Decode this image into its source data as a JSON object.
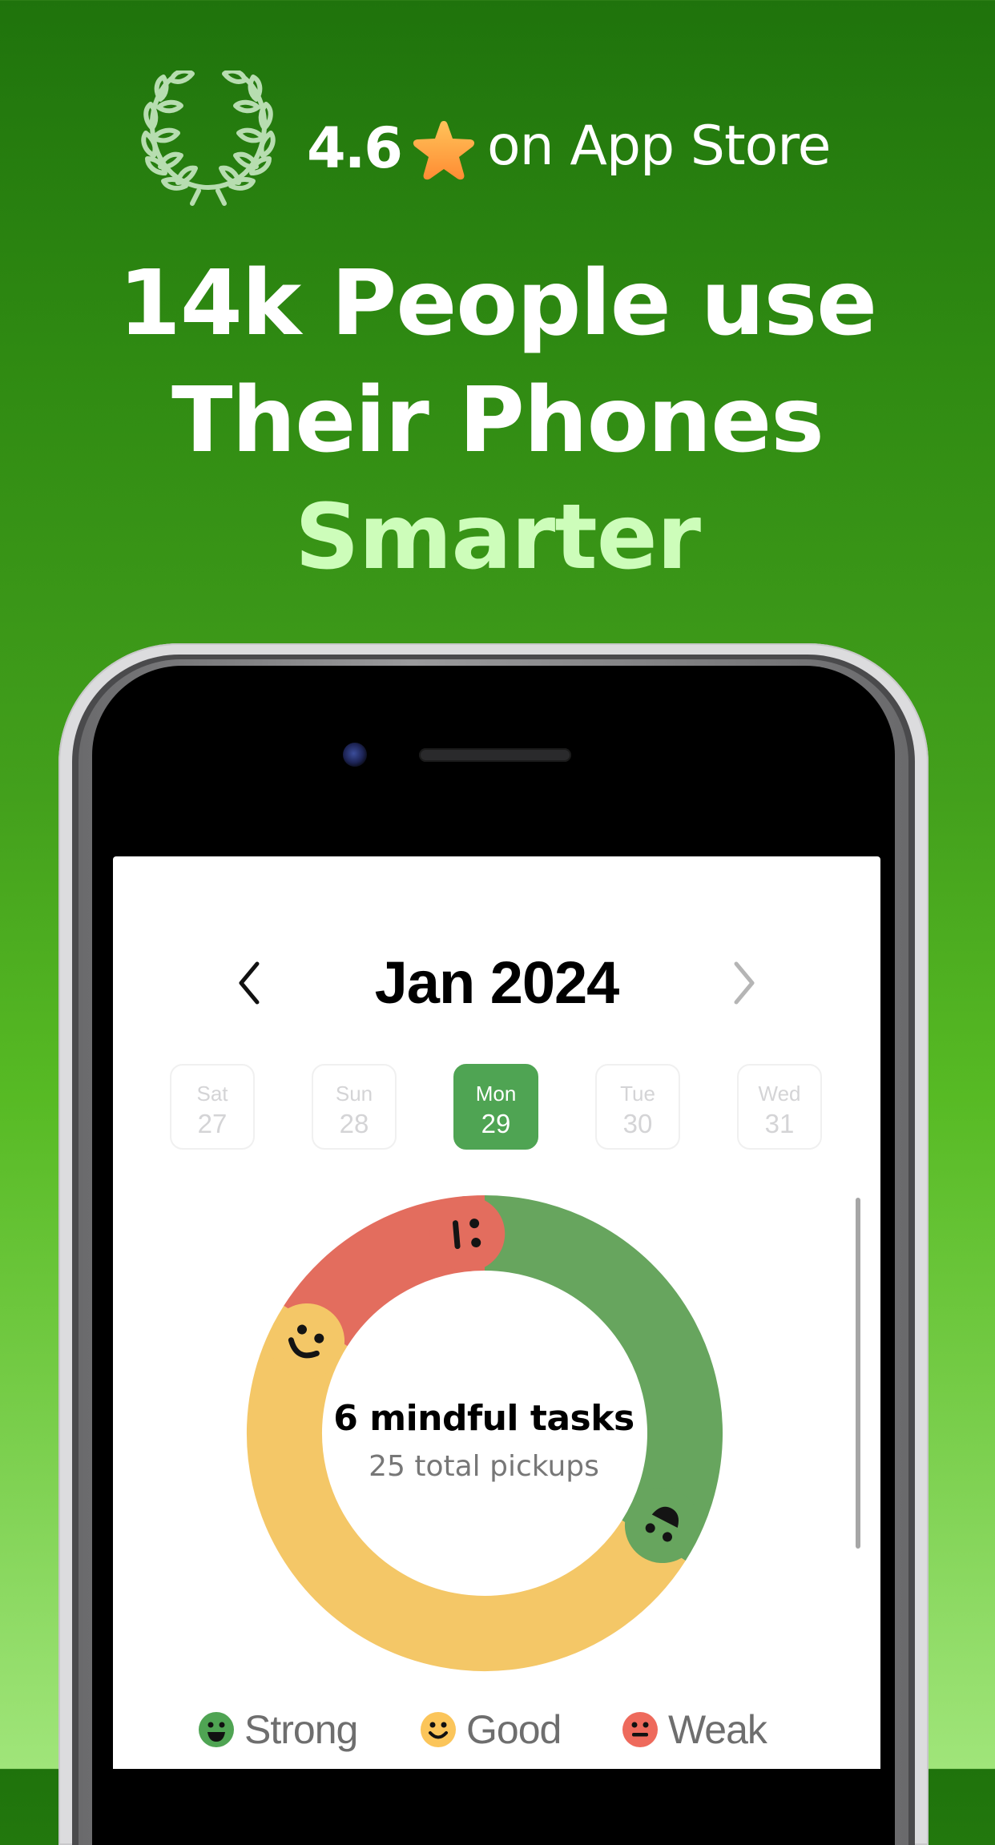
{
  "rating": {
    "value": "4.6",
    "suffix": "on App Store",
    "icons": {
      "laurel": "laurel-wreath-icon",
      "star": "star-icon"
    },
    "colors": {
      "laurel": "#B7DDB0",
      "star_top": "#FFC35A",
      "star_bottom": "#FF8C33"
    }
  },
  "headline": {
    "line1": "14k People use",
    "line2": "Their Phones",
    "line3": "Smarter",
    "highlight_color": "#CDFDBA"
  },
  "calendar": {
    "title": "Jan 2024",
    "prev_icon": "chevron-left-icon",
    "next_icon": "chevron-right-icon",
    "days": [
      {
        "name": "Sat",
        "number": "27",
        "selected": false
      },
      {
        "name": "Sun",
        "number": "28",
        "selected": false
      },
      {
        "name": "Mon",
        "number": "29",
        "selected": true
      },
      {
        "name": "Tue",
        "number": "30",
        "selected": false
      },
      {
        "name": "Wed",
        "number": "31",
        "selected": false
      }
    ],
    "accent_color": "#4FA453"
  },
  "summary": {
    "title": "6 mindful tasks",
    "subtitle": "25 total pickups"
  },
  "chart_data": {
    "type": "pie",
    "title": "6 mindful tasks",
    "subtitle": "25 total pickups",
    "categories": [
      "Strong",
      "Good",
      "Weak"
    ],
    "values": [
      34,
      50,
      16
    ],
    "unit": "percent of ring (approx.)",
    "start_angle_deg": 0,
    "colors": [
      "#67A55E",
      "#F4C767",
      "#E36D5E"
    ],
    "legend_position": "bottom"
  },
  "legend": [
    {
      "label": "Strong",
      "icon": "grinning-face-icon",
      "color": "#4FA453"
    },
    {
      "label": "Good",
      "icon": "smiling-face-icon",
      "color": "#FBC55A"
    },
    {
      "label": "Weak",
      "icon": "neutral-face-icon",
      "color": "#EE6A5C"
    }
  ]
}
